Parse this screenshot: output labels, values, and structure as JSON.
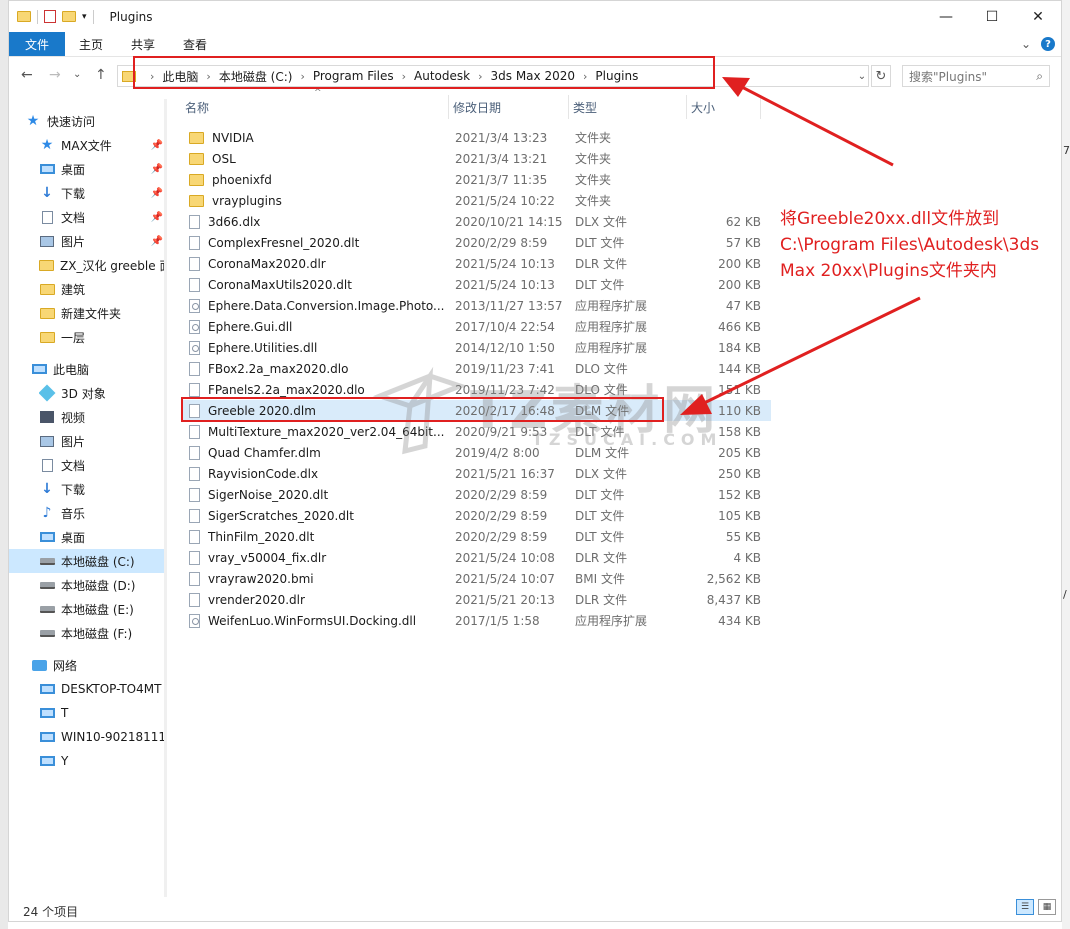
{
  "window": {
    "title": "Plugins",
    "minimize": "—",
    "maximize": "☐",
    "close": "✕"
  },
  "ribbon": {
    "tabs": [
      "文件",
      "主页",
      "共享",
      "查看"
    ],
    "expand": "⌄",
    "help": "?"
  },
  "nav": {
    "back": "←",
    "forward": "→",
    "recent": "⌄",
    "up": "↑",
    "breadcrumbs": [
      "此电脑",
      "本地磁盘 (C:)",
      "Program Files",
      "Autodesk",
      "3ds Max 2020",
      "Plugins"
    ],
    "sep": "›",
    "dropdown": "⌄",
    "refresh": "↻",
    "search_placeholder": "搜索\"Plugins\"",
    "search_icon": "⌕"
  },
  "sidebar": {
    "pin": "📌",
    "items": [
      {
        "label": "快速访问",
        "icon": "star-icon",
        "pinned": false
      },
      {
        "label": "MAX文件",
        "icon": "star-icon",
        "pinned": true
      },
      {
        "label": "桌面",
        "icon": "desktop-icon",
        "pinned": true
      },
      {
        "label": "下载",
        "icon": "download-icon",
        "pinned": true
      },
      {
        "label": "文档",
        "icon": "document-icon",
        "pinned": true
      },
      {
        "label": "图片",
        "icon": "pictures-icon",
        "pinned": true
      },
      {
        "label": "ZX_汉化 greeble 面",
        "icon": "folder-icon",
        "pinned": false
      },
      {
        "label": "建筑",
        "icon": "folder-icon",
        "pinned": false
      },
      {
        "label": "新建文件夹",
        "icon": "folder-icon",
        "pinned": false
      },
      {
        "label": "一层",
        "icon": "folder-icon",
        "pinned": false
      },
      {
        "label": "此电脑",
        "icon": "computer-icon",
        "pinned": false
      },
      {
        "label": "3D 对象",
        "icon": "3d-objects-icon",
        "pinned": false
      },
      {
        "label": "视频",
        "icon": "video-icon",
        "pinned": false
      },
      {
        "label": "图片",
        "icon": "pictures-icon",
        "pinned": false
      },
      {
        "label": "文档",
        "icon": "document-icon",
        "pinned": false
      },
      {
        "label": "下载",
        "icon": "download-icon",
        "pinned": false
      },
      {
        "label": "音乐",
        "icon": "music-icon",
        "pinned": false
      },
      {
        "label": "桌面",
        "icon": "desktop-icon",
        "pinned": false
      },
      {
        "label": "本地磁盘 (C:)",
        "icon": "drive-icon",
        "pinned": false,
        "selected": true
      },
      {
        "label": "本地磁盘 (D:)",
        "icon": "drive-icon",
        "pinned": false
      },
      {
        "label": "本地磁盘 (E:)",
        "icon": "drive-icon",
        "pinned": false
      },
      {
        "label": "本地磁盘 (F:)",
        "icon": "drive-icon",
        "pinned": false
      },
      {
        "label": "网络",
        "icon": "network-icon",
        "pinned": false
      },
      {
        "label": "DESKTOP-TO4MT",
        "icon": "computer-icon",
        "pinned": false
      },
      {
        "label": "T",
        "icon": "computer-icon",
        "pinned": false
      },
      {
        "label": "WIN10-90218111",
        "icon": "computer-icon",
        "pinned": false
      },
      {
        "label": "Y",
        "icon": "computer-icon",
        "pinned": false
      }
    ]
  },
  "columns": {
    "name": "名称",
    "date": "修改日期",
    "type": "类型",
    "size": "大小",
    "sort_caret": "^"
  },
  "files": [
    {
      "name": "NVIDIA",
      "date": "2021/3/4 13:23",
      "type": "文件夹",
      "size": "",
      "kind": "folder"
    },
    {
      "name": "OSL",
      "date": "2021/3/4 13:21",
      "type": "文件夹",
      "size": "",
      "kind": "folder"
    },
    {
      "name": "phoenixfd",
      "date": "2021/3/7 11:35",
      "type": "文件夹",
      "size": "",
      "kind": "folder"
    },
    {
      "name": "vrayplugins",
      "date": "2021/5/24 10:22",
      "type": "文件夹",
      "size": "",
      "kind": "folder"
    },
    {
      "name": "3d66.dlx",
      "date": "2020/10/21 14:15",
      "type": "DLX 文件",
      "size": "62 KB",
      "kind": "file"
    },
    {
      "name": "ComplexFresnel_2020.dlt",
      "date": "2020/2/29 8:59",
      "type": "DLT 文件",
      "size": "57 KB",
      "kind": "file"
    },
    {
      "name": "CoronaMax2020.dlr",
      "date": "2021/5/24 10:13",
      "type": "DLR 文件",
      "size": "200 KB",
      "kind": "file"
    },
    {
      "name": "CoronaMaxUtils2020.dlt",
      "date": "2021/5/24 10:13",
      "type": "DLT 文件",
      "size": "200 KB",
      "kind": "file"
    },
    {
      "name": "Ephere.Data.Conversion.Image.Photo...",
      "date": "2013/11/27 13:57",
      "type": "应用程序扩展",
      "size": "47 KB",
      "kind": "dll"
    },
    {
      "name": "Ephere.Gui.dll",
      "date": "2017/10/4 22:54",
      "type": "应用程序扩展",
      "size": "466 KB",
      "kind": "dll"
    },
    {
      "name": "Ephere.Utilities.dll",
      "date": "2014/12/10 1:50",
      "type": "应用程序扩展",
      "size": "184 KB",
      "kind": "dll"
    },
    {
      "name": "FBox2.2a_max2020.dlo",
      "date": "2019/11/23 7:41",
      "type": "DLO 文件",
      "size": "144 KB",
      "kind": "file"
    },
    {
      "name": "FPanels2.2a_max2020.dlo",
      "date": "2019/11/23 7:42",
      "type": "DLO 文件",
      "size": "151 KB",
      "kind": "file"
    },
    {
      "name": "Greeble 2020.dlm",
      "date": "2020/2/17 16:48",
      "type": "DLM 文件",
      "size": "110 KB",
      "kind": "file",
      "selected": true
    },
    {
      "name": "MultiTexture_max2020_ver2.04_64bit...",
      "date": "2020/9/21 9:53",
      "type": "DLT 文件",
      "size": "158 KB",
      "kind": "file"
    },
    {
      "name": "Quad Chamfer.dlm",
      "date": "2019/4/2 8:00",
      "type": "DLM 文件",
      "size": "205 KB",
      "kind": "file"
    },
    {
      "name": "RayvisionCode.dlx",
      "date": "2021/5/21 16:37",
      "type": "DLX 文件",
      "size": "250 KB",
      "kind": "file"
    },
    {
      "name": "SigerNoise_2020.dlt",
      "date": "2020/2/29 8:59",
      "type": "DLT 文件",
      "size": "152 KB",
      "kind": "file"
    },
    {
      "name": "SigerScratches_2020.dlt",
      "date": "2020/2/29 8:59",
      "type": "DLT 文件",
      "size": "105 KB",
      "kind": "file"
    },
    {
      "name": "ThinFilm_2020.dlt",
      "date": "2020/2/29 8:59",
      "type": "DLT 文件",
      "size": "55 KB",
      "kind": "file"
    },
    {
      "name": "vray_v50004_fix.dlr",
      "date": "2021/5/24 10:08",
      "type": "DLR 文件",
      "size": "4 KB",
      "kind": "file"
    },
    {
      "name": "vrayraw2020.bmi",
      "date": "2021/5/24 10:07",
      "type": "BMI 文件",
      "size": "2,562 KB",
      "kind": "file"
    },
    {
      "name": "vrender2020.dlr",
      "date": "2021/5/21 20:13",
      "type": "DLR 文件",
      "size": "8,437 KB",
      "kind": "file"
    },
    {
      "name": "WeifenLuo.WinFormsUI.Docking.dll",
      "date": "2017/1/5 1:58",
      "type": "应用程序扩展",
      "size": "434 KB",
      "kind": "dll"
    }
  ],
  "status": {
    "count": "24 个项目"
  },
  "annotation": {
    "text": "将Greeble20xx.dll文件放到C:\\Program Files\\Autodesk\\3ds Max 20xx\\Plugins文件夹内",
    "color": "#e02020"
  },
  "watermark": {
    "brand": "TZ素材网",
    "domain": "TZSUCAI.COM"
  },
  "colors": {
    "accent": "#1979ca",
    "selection": "#cce8ff"
  }
}
